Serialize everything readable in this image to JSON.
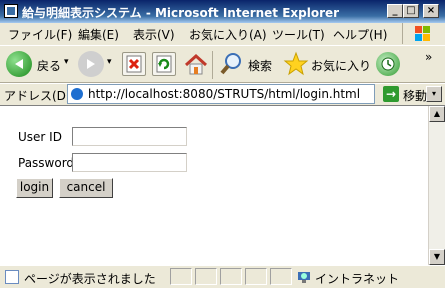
{
  "window": {
    "title": "給与明細表示システム - Microsoft Internet Explorer",
    "controls": {
      "minimize": "_",
      "maximize": "□",
      "close": "×"
    }
  },
  "menu": [
    "ファイル(F)",
    "編集(E)",
    "表示(V)",
    "お気に入り(A)",
    "ツール(T)",
    "ヘルプ(H)"
  ],
  "toolbar": {
    "back_label": "戻る",
    "search_label": "検索",
    "favorites_label": "お気に入り",
    "chevron": "»",
    "dropdown": "▾"
  },
  "address": {
    "label": "アドレス(D)",
    "url": "http://localhost:8080/STRUTS/html/login.html",
    "go_label": "移動",
    "go_arrow": "→"
  },
  "form": {
    "userid_label": "User ID",
    "password_label": "Password",
    "userid_value": "",
    "password_value": "",
    "login_label": "login",
    "cancel_label": "cancel"
  },
  "scroll": {
    "up": "▲",
    "down": "▼"
  },
  "status": {
    "text": "ページが表示されました",
    "zone": "イントラネット"
  },
  "colors": {
    "title_bar": "#0a246a",
    "chrome": "#ece9d8",
    "content_bg": "#ffffff"
  }
}
